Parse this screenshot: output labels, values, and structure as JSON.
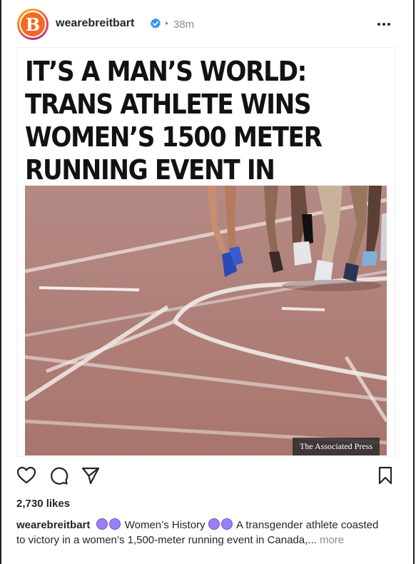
{
  "header": {
    "avatar_letter": "B",
    "username": "wearebreitbart",
    "separator": "•",
    "time": "38m"
  },
  "post": {
    "headline": "IT’S A MAN’S WORLD: TRANS ATHLETE WINS WOMEN’S 1500 METER RUNNING EVENT IN CANADA",
    "photo_credit": "The Associated Press"
  },
  "actions": {
    "like_icon": "heart-icon",
    "comment_icon": "comment-icon",
    "share_icon": "send-icon",
    "save_icon": "bookmark-icon"
  },
  "likes_text": "2,730 likes",
  "caption": {
    "username": "wearebreitbart",
    "tag": "Women’s History",
    "text": "A transgender athlete coasted to victory in a women’s 1,500-meter running event in Canada,...",
    "more": "more"
  },
  "colors": {
    "track": "#b07f78",
    "brand_orange": "#f26a21",
    "verified_blue": "#3897f0",
    "emoji_purple": "#9d7ff5"
  }
}
